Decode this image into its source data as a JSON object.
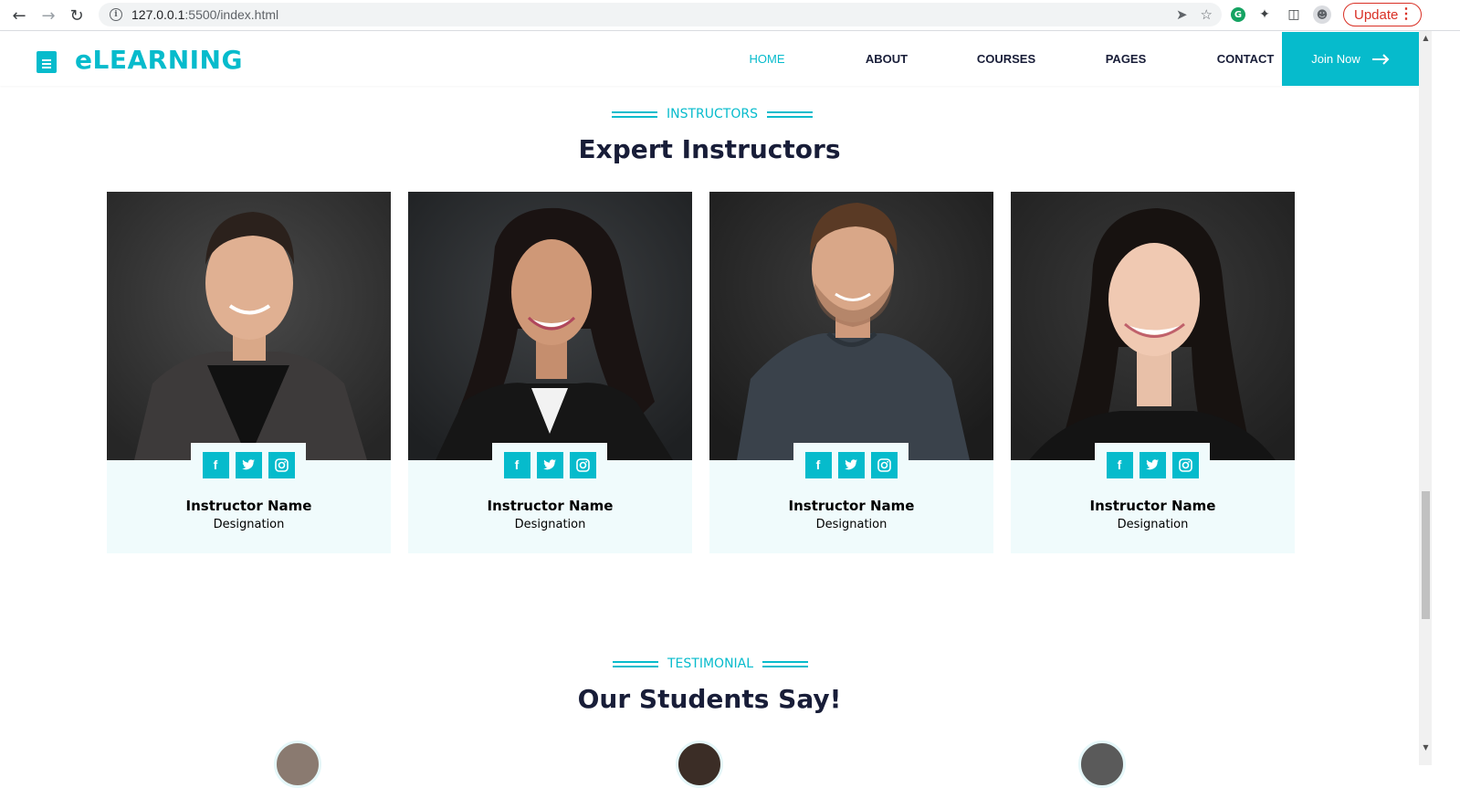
{
  "browser": {
    "url_host": "127.0.0.1",
    "url_rest": ":5500/index.html",
    "update_label": "Update"
  },
  "site": {
    "brand": "eLEARNING",
    "nav": [
      {
        "label": "HOME",
        "active": true
      },
      {
        "label": "ABOUT",
        "active": false
      },
      {
        "label": "COURSES",
        "active": false
      },
      {
        "label": "PAGES",
        "active": false
      },
      {
        "label": "CONTACT",
        "active": false
      }
    ],
    "join_label": "Join Now",
    "accent_color": "#06BBCC",
    "heading_color": "#181d38"
  },
  "instructors": {
    "tag": "INSTRUCTORS",
    "title": "Expert Instructors",
    "cards": [
      {
        "name": "Instructor Name",
        "designation": "Designation",
        "socials": [
          "facebook-icon",
          "twitter-icon",
          "instagram-icon"
        ]
      },
      {
        "name": "Instructor Name",
        "designation": "Designation",
        "socials": [
          "facebook-icon",
          "twitter-icon",
          "instagram-icon"
        ]
      },
      {
        "name": "Instructor Name",
        "designation": "Designation",
        "socials": [
          "facebook-icon",
          "twitter-icon",
          "instagram-icon"
        ]
      },
      {
        "name": "Instructor Name",
        "designation": "Designation",
        "socials": [
          "facebook-icon",
          "twitter-icon",
          "instagram-icon"
        ]
      }
    ]
  },
  "testimonial": {
    "tag": "TESTIMONIAL",
    "title": "Our Students Say!"
  }
}
